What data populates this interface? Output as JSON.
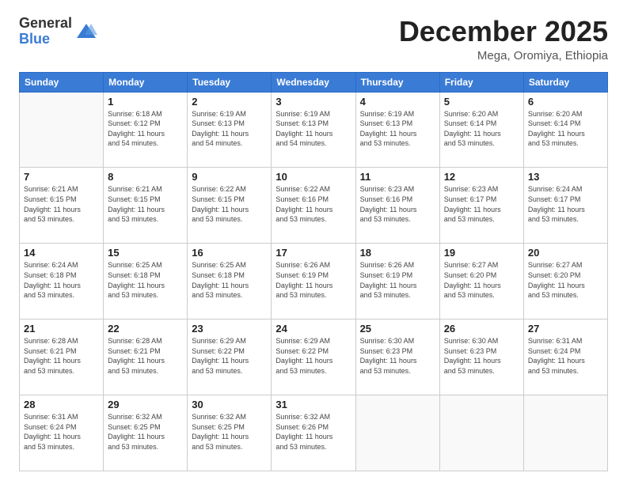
{
  "logo": {
    "general": "General",
    "blue": "Blue"
  },
  "header": {
    "month": "December 2025",
    "location": "Mega, Oromiya, Ethiopia"
  },
  "weekdays": [
    "Sunday",
    "Monday",
    "Tuesday",
    "Wednesday",
    "Thursday",
    "Friday",
    "Saturday"
  ],
  "weeks": [
    [
      {
        "day": "",
        "info": ""
      },
      {
        "day": "1",
        "info": "Sunrise: 6:18 AM\nSunset: 6:12 PM\nDaylight: 11 hours\nand 54 minutes."
      },
      {
        "day": "2",
        "info": "Sunrise: 6:19 AM\nSunset: 6:13 PM\nDaylight: 11 hours\nand 54 minutes."
      },
      {
        "day": "3",
        "info": "Sunrise: 6:19 AM\nSunset: 6:13 PM\nDaylight: 11 hours\nand 54 minutes."
      },
      {
        "day": "4",
        "info": "Sunrise: 6:19 AM\nSunset: 6:13 PM\nDaylight: 11 hours\nand 53 minutes."
      },
      {
        "day": "5",
        "info": "Sunrise: 6:20 AM\nSunset: 6:14 PM\nDaylight: 11 hours\nand 53 minutes."
      },
      {
        "day": "6",
        "info": "Sunrise: 6:20 AM\nSunset: 6:14 PM\nDaylight: 11 hours\nand 53 minutes."
      }
    ],
    [
      {
        "day": "7",
        "info": "Sunrise: 6:21 AM\nSunset: 6:15 PM\nDaylight: 11 hours\nand 53 minutes."
      },
      {
        "day": "8",
        "info": "Sunrise: 6:21 AM\nSunset: 6:15 PM\nDaylight: 11 hours\nand 53 minutes."
      },
      {
        "day": "9",
        "info": "Sunrise: 6:22 AM\nSunset: 6:15 PM\nDaylight: 11 hours\nand 53 minutes."
      },
      {
        "day": "10",
        "info": "Sunrise: 6:22 AM\nSunset: 6:16 PM\nDaylight: 11 hours\nand 53 minutes."
      },
      {
        "day": "11",
        "info": "Sunrise: 6:23 AM\nSunset: 6:16 PM\nDaylight: 11 hours\nand 53 minutes."
      },
      {
        "day": "12",
        "info": "Sunrise: 6:23 AM\nSunset: 6:17 PM\nDaylight: 11 hours\nand 53 minutes."
      },
      {
        "day": "13",
        "info": "Sunrise: 6:24 AM\nSunset: 6:17 PM\nDaylight: 11 hours\nand 53 minutes."
      }
    ],
    [
      {
        "day": "14",
        "info": "Sunrise: 6:24 AM\nSunset: 6:18 PM\nDaylight: 11 hours\nand 53 minutes."
      },
      {
        "day": "15",
        "info": "Sunrise: 6:25 AM\nSunset: 6:18 PM\nDaylight: 11 hours\nand 53 minutes."
      },
      {
        "day": "16",
        "info": "Sunrise: 6:25 AM\nSunset: 6:18 PM\nDaylight: 11 hours\nand 53 minutes."
      },
      {
        "day": "17",
        "info": "Sunrise: 6:26 AM\nSunset: 6:19 PM\nDaylight: 11 hours\nand 53 minutes."
      },
      {
        "day": "18",
        "info": "Sunrise: 6:26 AM\nSunset: 6:19 PM\nDaylight: 11 hours\nand 53 minutes."
      },
      {
        "day": "19",
        "info": "Sunrise: 6:27 AM\nSunset: 6:20 PM\nDaylight: 11 hours\nand 53 minutes."
      },
      {
        "day": "20",
        "info": "Sunrise: 6:27 AM\nSunset: 6:20 PM\nDaylight: 11 hours\nand 53 minutes."
      }
    ],
    [
      {
        "day": "21",
        "info": "Sunrise: 6:28 AM\nSunset: 6:21 PM\nDaylight: 11 hours\nand 53 minutes."
      },
      {
        "day": "22",
        "info": "Sunrise: 6:28 AM\nSunset: 6:21 PM\nDaylight: 11 hours\nand 53 minutes."
      },
      {
        "day": "23",
        "info": "Sunrise: 6:29 AM\nSunset: 6:22 PM\nDaylight: 11 hours\nand 53 minutes."
      },
      {
        "day": "24",
        "info": "Sunrise: 6:29 AM\nSunset: 6:22 PM\nDaylight: 11 hours\nand 53 minutes."
      },
      {
        "day": "25",
        "info": "Sunrise: 6:30 AM\nSunset: 6:23 PM\nDaylight: 11 hours\nand 53 minutes."
      },
      {
        "day": "26",
        "info": "Sunrise: 6:30 AM\nSunset: 6:23 PM\nDaylight: 11 hours\nand 53 minutes."
      },
      {
        "day": "27",
        "info": "Sunrise: 6:31 AM\nSunset: 6:24 PM\nDaylight: 11 hours\nand 53 minutes."
      }
    ],
    [
      {
        "day": "28",
        "info": "Sunrise: 6:31 AM\nSunset: 6:24 PM\nDaylight: 11 hours\nand 53 minutes."
      },
      {
        "day": "29",
        "info": "Sunrise: 6:32 AM\nSunset: 6:25 PM\nDaylight: 11 hours\nand 53 minutes."
      },
      {
        "day": "30",
        "info": "Sunrise: 6:32 AM\nSunset: 6:25 PM\nDaylight: 11 hours\nand 53 minutes."
      },
      {
        "day": "31",
        "info": "Sunrise: 6:32 AM\nSunset: 6:26 PM\nDaylight: 11 hours\nand 53 minutes."
      },
      {
        "day": "",
        "info": ""
      },
      {
        "day": "",
        "info": ""
      },
      {
        "day": "",
        "info": ""
      }
    ]
  ]
}
